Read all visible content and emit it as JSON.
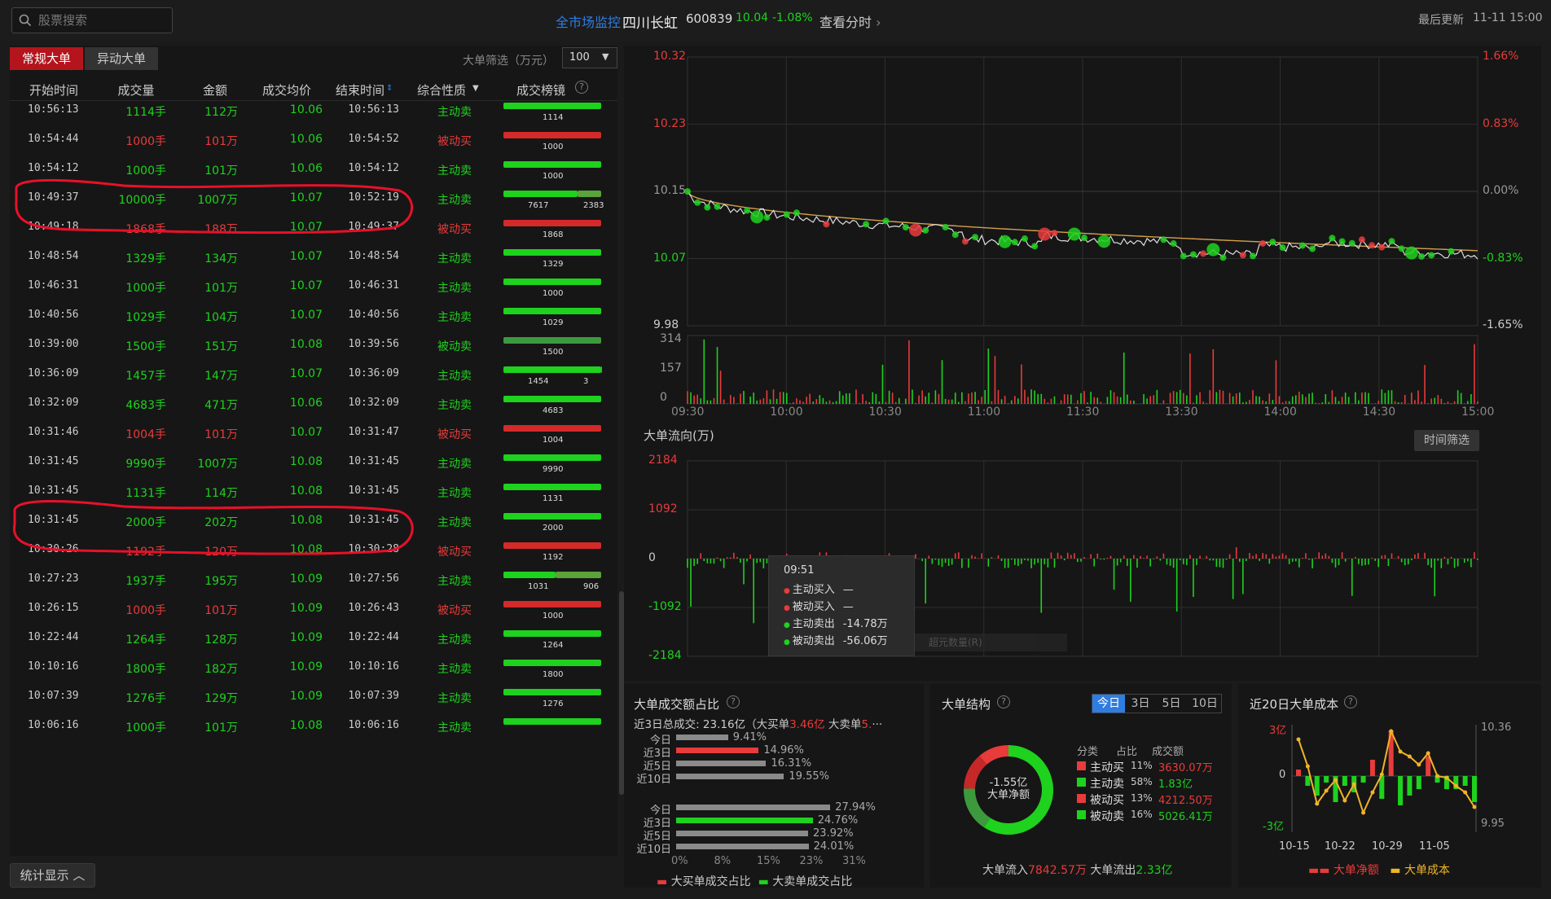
{
  "header": {
    "search_placeholder": "股票搜索",
    "market_monitor": "全市场监控",
    "stock_name": "四川长虹",
    "stock_code": "600839",
    "price": "10.04",
    "change_pct": "-1.08%",
    "intraday_link": "查看分时",
    "last_update_label": "最后更新",
    "last_update_time": "11-11 15:00"
  },
  "left": {
    "tabs": [
      "常规大单",
      "异动大单"
    ],
    "filter_label": "大单筛选（万元）",
    "filter_value": "100",
    "columns": [
      "开始时间",
      "成交量",
      "金额",
      "成交均价",
      "结束时间",
      "综合性质",
      "成交榜镜"
    ],
    "rows": [
      {
        "start": "10:56:13",
        "vol": "1114手",
        "amt": "112万",
        "price": "10.06",
        "end": "10:56:13",
        "nature": "主动卖",
        "buy": 0,
        "sell": 1114,
        "color": "green",
        "bar_labels": [
          "1114"
        ]
      },
      {
        "start": "10:54:44",
        "vol": "1000手",
        "amt": "101万",
        "price": "10.06",
        "end": "10:54:52",
        "nature": "被动买",
        "buy": 1000,
        "sell": 0,
        "color": "red",
        "bar_labels": [
          "1000"
        ]
      },
      {
        "start": "10:54:12",
        "vol": "1000手",
        "amt": "101万",
        "price": "10.06",
        "end": "10:54:12",
        "nature": "主动卖",
        "buy": 0,
        "sell": 1000,
        "color": "green",
        "bar_labels": [
          "1000"
        ]
      },
      {
        "start": "10:49:37",
        "vol": "10000手",
        "amt": "1007万",
        "price": "10.07",
        "end": "10:52:19",
        "nature": "主动卖",
        "buy": 7617,
        "sell": 2383,
        "color": "green",
        "bar_labels": [
          "7617",
          "2383"
        ]
      },
      {
        "start": "10:49:18",
        "vol": "1868手",
        "amt": "188万",
        "price": "10.07",
        "end": "10:49:37",
        "nature": "被动买",
        "buy": 1868,
        "sell": 0,
        "color": "red",
        "bar_labels": [
          "1868"
        ]
      },
      {
        "start": "10:48:54",
        "vol": "1329手",
        "amt": "134万",
        "price": "10.07",
        "end": "10:48:54",
        "nature": "主动卖",
        "buy": 0,
        "sell": 1329,
        "color": "green",
        "bar_labels": [
          "1329"
        ]
      },
      {
        "start": "10:46:31",
        "vol": "1000手",
        "amt": "101万",
        "price": "10.07",
        "end": "10:46:31",
        "nature": "主动卖",
        "buy": 0,
        "sell": 1000,
        "color": "green",
        "bar_labels": [
          "1000"
        ]
      },
      {
        "start": "10:40:56",
        "vol": "1029手",
        "amt": "104万",
        "price": "10.07",
        "end": "10:40:56",
        "nature": "主动卖",
        "buy": 0,
        "sell": 1029,
        "color": "green",
        "bar_labels": [
          "1029"
        ]
      },
      {
        "start": "10:39:00",
        "vol": "1500手",
        "amt": "151万",
        "price": "10.08",
        "end": "10:39:56",
        "nature": "被动卖",
        "buy": 0,
        "sell": 1500,
        "color": "green",
        "bar_labels": [
          "1500"
        ]
      },
      {
        "start": "10:36:09",
        "vol": "1457手",
        "amt": "147万",
        "price": "10.07",
        "end": "10:36:09",
        "nature": "主动卖",
        "buy": 1454,
        "sell": 3,
        "color": "green",
        "bar_labels": [
          "1454",
          "3"
        ]
      },
      {
        "start": "10:32:09",
        "vol": "4683手",
        "amt": "471万",
        "price": "10.06",
        "end": "10:32:09",
        "nature": "主动卖",
        "buy": 0,
        "sell": 4683,
        "color": "green",
        "bar_labels": [
          "4683"
        ]
      },
      {
        "start": "10:31:46",
        "vol": "1004手",
        "amt": "101万",
        "price": "10.07",
        "end": "10:31:47",
        "nature": "被动买",
        "buy": 1004,
        "sell": 0,
        "color": "red",
        "bar_labels": [
          "1004"
        ]
      },
      {
        "start": "10:31:45",
        "vol": "9990手",
        "amt": "1007万",
        "price": "10.08",
        "end": "10:31:45",
        "nature": "主动卖",
        "buy": 0,
        "sell": 9990,
        "color": "green",
        "bar_labels": [
          "9990"
        ]
      },
      {
        "start": "10:31:45",
        "vol": "1131手",
        "amt": "114万",
        "price": "10.08",
        "end": "10:31:45",
        "nature": "主动卖",
        "buy": 0,
        "sell": 1131,
        "color": "green",
        "bar_labels": [
          "1131"
        ]
      },
      {
        "start": "10:31:45",
        "vol": "2000手",
        "amt": "202万",
        "price": "10.08",
        "end": "10:31:45",
        "nature": "主动卖",
        "buy": 0,
        "sell": 2000,
        "color": "green",
        "bar_labels": [
          "2000"
        ]
      },
      {
        "start": "10:30:26",
        "vol": "1192手",
        "amt": "120万",
        "price": "10.08",
        "end": "10:30:28",
        "nature": "被动买",
        "buy": 1192,
        "sell": 0,
        "color": "red",
        "bar_labels": [
          "1192"
        ]
      },
      {
        "start": "10:27:23",
        "vol": "1937手",
        "amt": "195万",
        "price": "10.09",
        "end": "10:27:56",
        "nature": "主动卖",
        "buy": 1031,
        "sell": 906,
        "color": "green",
        "bar_labels": [
          "1031",
          "906"
        ]
      },
      {
        "start": "10:26:15",
        "vol": "1000手",
        "amt": "101万",
        "price": "10.09",
        "end": "10:26:43",
        "nature": "被动买",
        "buy": 1000,
        "sell": 0,
        "color": "red",
        "bar_labels": [
          "1000"
        ]
      },
      {
        "start": "10:22:44",
        "vol": "1264手",
        "amt": "128万",
        "price": "10.09",
        "end": "10:22:44",
        "nature": "主动卖",
        "buy": 0,
        "sell": 1264,
        "color": "green",
        "bar_labels": [
          "1264"
        ]
      },
      {
        "start": "10:10:16",
        "vol": "1800手",
        "amt": "182万",
        "price": "10.09",
        "end": "10:10:16",
        "nature": "主动卖",
        "buy": 0,
        "sell": 1800,
        "color": "green",
        "bar_labels": [
          "1800"
        ]
      },
      {
        "start": "10:07:39",
        "vol": "1276手",
        "amt": "129万",
        "price": "10.09",
        "end": "10:07:39",
        "nature": "主动卖",
        "buy": 0,
        "sell": 1276,
        "color": "green",
        "bar_labels": [
          "1276"
        ]
      },
      {
        "start": "10:06:16",
        "vol": "1000手",
        "amt": "101万",
        "price": "10.08",
        "end": "10:06:16",
        "nature": "主动卖",
        "buy": 0,
        "sell": 1000,
        "color": "green",
        "bar_labels": []
      }
    ],
    "footer_button": "统计显示"
  },
  "price_chart": {
    "y_labels": [
      "10.32",
      "10.23",
      "10.15",
      "10.07",
      "9.98"
    ],
    "pct_labels": [
      "1.66%",
      "0.83%",
      "0.00%",
      "-0.83%",
      "-1.65%"
    ],
    "vol_labels": [
      "314",
      "157",
      "0"
    ],
    "x_labels": [
      "09:30",
      "10:00",
      "10:30",
      "11:00",
      "11:30",
      "13:30",
      "14:00",
      "14:30",
      "15:00"
    ]
  },
  "flow_chart": {
    "title": "大单流向(万)",
    "filter_button": "时间筛选",
    "y_labels": [
      "2184",
      "1092",
      "0",
      "-1092",
      "-2184"
    ],
    "tooltip": {
      "time": "09:51",
      "items": [
        {
          "label": "主动买入",
          "value": "—",
          "color": "#e83b3b"
        },
        {
          "label": "被动买入",
          "value": "—",
          "color": "#e83b3b"
        },
        {
          "label": "主动卖出",
          "value": "-14.78万",
          "color": "#1ed21e"
        },
        {
          "label": "被动卖出",
          "value": "-56.06万",
          "color": "#1ed21e"
        }
      ]
    },
    "faded_label": "超元数量(R)"
  },
  "ratio_panel": {
    "title": "大单成交额占比",
    "summary_prefix": "近3日总成交: 23.16亿（大买单",
    "summary_buy": "3.46亿",
    "summary_mid": " 大卖单",
    "summary_sell": "5.",
    "summary_more": "···",
    "buy_rows": [
      {
        "label": "今日",
        "value": 9.41,
        "text": "9.41%",
        "color": "#8a8a8a"
      },
      {
        "label": "近3日",
        "value": 14.96,
        "text": "14.96%",
        "color": "#e83b3b"
      },
      {
        "label": "近5日",
        "value": 16.31,
        "text": "16.31%",
        "color": "#8a8a8a"
      },
      {
        "label": "近10日",
        "value": 19.55,
        "text": "19.55%",
        "color": "#8a8a8a"
      }
    ],
    "sell_rows": [
      {
        "label": "今日",
        "value": 27.94,
        "text": "27.94%",
        "color": "#8a8a8a"
      },
      {
        "label": "近3日",
        "value": 24.76,
        "text": "24.76%",
        "color": "#1ed21e"
      },
      {
        "label": "近5日",
        "value": 23.92,
        "text": "23.92%",
        "color": "#8a8a8a"
      },
      {
        "label": "近10日",
        "value": 24.01,
        "text": "24.01%",
        "color": "#8a8a8a"
      }
    ],
    "x_ticks": [
      "0%",
      "8%",
      "15%",
      "23%",
      "31%"
    ],
    "legend": [
      "大买单成交占比",
      "大卖单成交占比"
    ]
  },
  "structure_panel": {
    "title": "大单结构",
    "period_tabs": [
      "今日",
      "3日",
      "5日",
      "10日"
    ],
    "donut_value": "-1.55亿",
    "donut_label": "大单净额",
    "headers": [
      "分类",
      "占比",
      "成交额"
    ],
    "rows": [
      {
        "name": "主动买",
        "pct": "11%",
        "amount": "3630.07万",
        "color": "#e83b3b",
        "share": 11
      },
      {
        "name": "主动卖",
        "pct": "58%",
        "amount": "1.83亿",
        "color": "#1ed21e",
        "share": 58
      },
      {
        "name": "被动买",
        "pct": "13%",
        "amount": "4212.50万",
        "color": "#e83b3b",
        "share": 13
      },
      {
        "name": "被动卖",
        "pct": "16%",
        "amount": "5026.41万",
        "color": "#1ed21e",
        "share": 16
      }
    ],
    "inflow_label": "大单流入",
    "inflow_value": "7842.57万",
    "outflow_label": "大单流出",
    "outflow_value": "2.33亿"
  },
  "cost_panel": {
    "title": "近20日大单成本",
    "left_labels": [
      "3亿",
      "0",
      "-3亿"
    ],
    "right_labels": [
      "10.36",
      "9.95"
    ],
    "x_labels": [
      "10-15",
      "10-22",
      "10-29",
      "11-05"
    ],
    "legend": [
      "大单净额",
      "大单成本"
    ]
  },
  "colors": {
    "up": "#e83b3b",
    "down": "#1ed21e",
    "accent": "#2f7de1",
    "bg": "#161616",
    "annotation": "#e8102a"
  }
}
